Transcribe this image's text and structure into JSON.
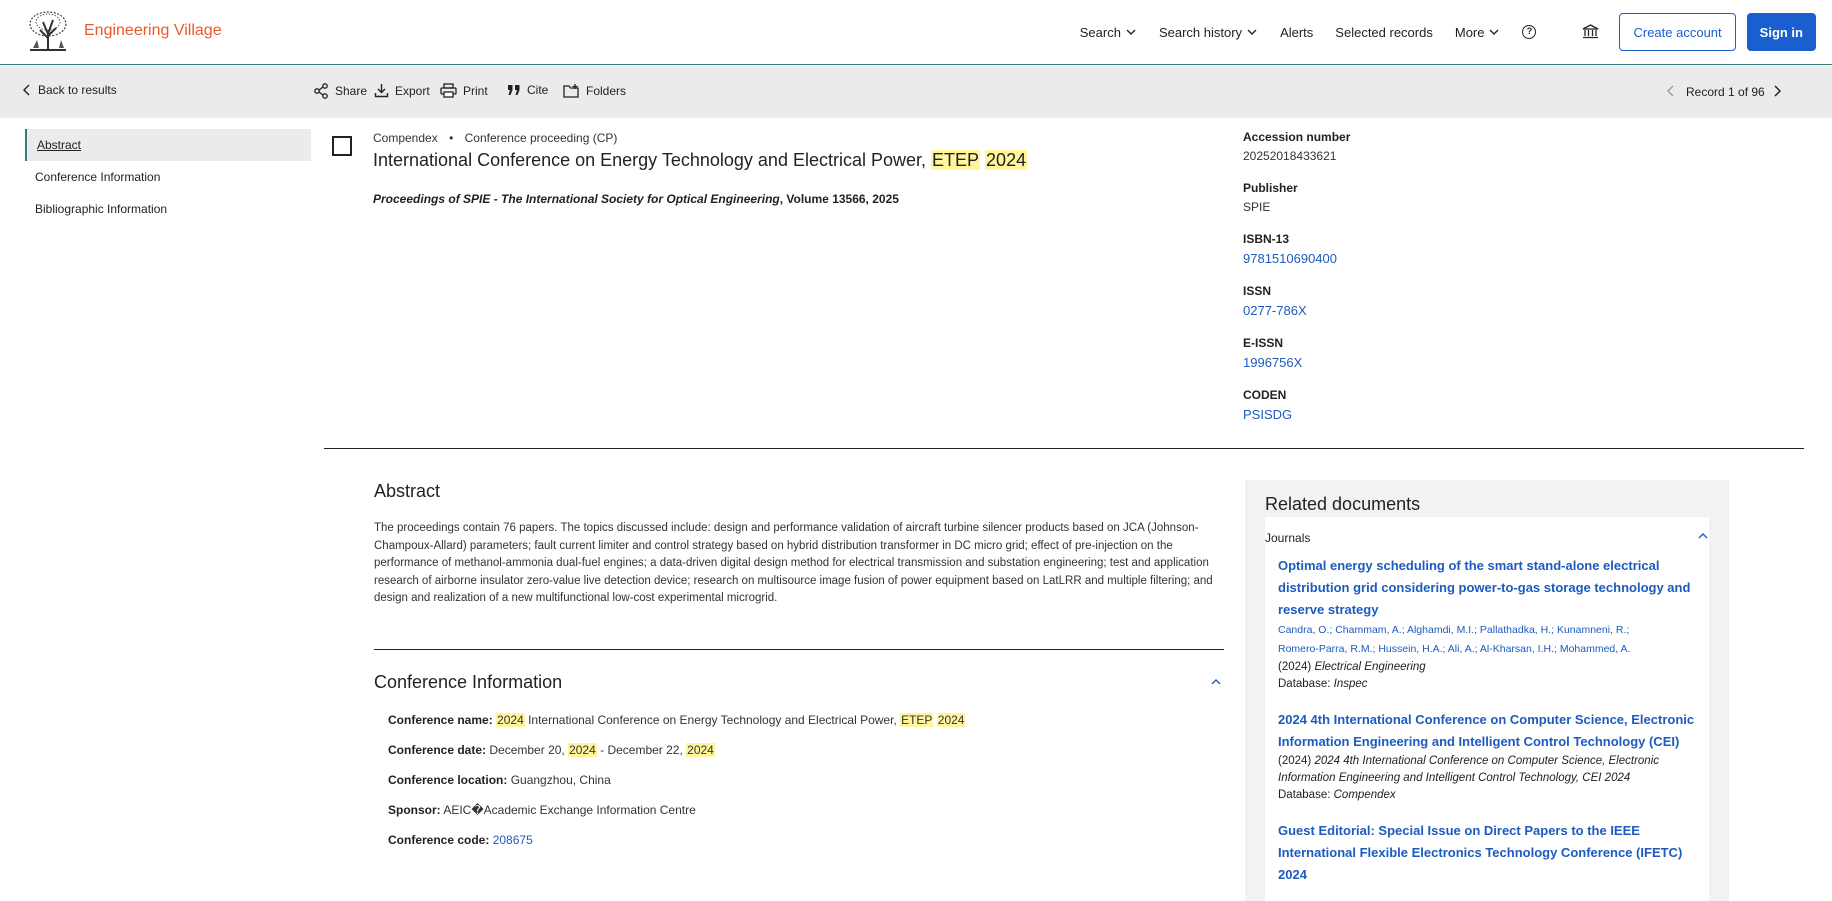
{
  "header": {
    "brand": "Engineering Village",
    "nav": {
      "search": "Search",
      "search_history": "Search history",
      "alerts": "Alerts",
      "selected_records": "Selected records",
      "more": "More"
    },
    "create_account": "Create account",
    "sign_in": "Sign in"
  },
  "toolbar": {
    "back": "Back to results",
    "share": "Share",
    "export": "Export",
    "print": "Print",
    "cite": "Cite",
    "folders": "Folders",
    "record_position": "Record 1 of 96"
  },
  "leftnav": {
    "abstract": "Abstract",
    "conference_information": "Conference Information",
    "bibliographic_information": "Bibliographic Information"
  },
  "record": {
    "database": "Compendex",
    "doc_type": "Conference proceeding (CP)",
    "title_main": "International Conference on Energy Technology and Electrical Power, ",
    "title_hl1": "ETEP",
    "title_hl2": "2024",
    "source_italic": "Proceedings of SPIE - The International Society for Optical Engineering",
    "source_rest": ", Volume 13566, 2025"
  },
  "meta": {
    "accession_label": "Accession number",
    "accession_value": "20252018433621",
    "publisher_label": "Publisher",
    "publisher_value": "SPIE",
    "isbn_label": "ISBN-13",
    "isbn_value": "9781510690400",
    "issn_label": "ISSN",
    "issn_value": "0277-786X",
    "eissn_label": "E-ISSN",
    "eissn_value": "1996756X",
    "coden_label": "CODEN",
    "coden_value": "PSISDG"
  },
  "abstract": {
    "title": "Abstract",
    "text": "The proceedings contain 76 papers. The topics discussed include: design and performance validation of aircraft turbine silencer products based on JCA (Johnson-Champoux-Allard) parameters; fault current limiter and control strategy based on hybrid distribution transformer in DC micro grid; effect of pre-injection on the performance of methanol-ammonia dual-fuel engines; a data-driven digital design method for electrical transmission and substation engineering; test and application research of airborne insulator zero-value live detection device; research on multisource image fusion of power equipment based on LatLRR and multiple filtering; and design and realization of a new multifunctional low-cost experimental microgrid."
  },
  "conference": {
    "title": "Conference Information",
    "name_label": "Conference name:",
    "name_hl_year": "2024",
    "name_text": " International Conference on Energy Technology and Electrical Power, ",
    "name_hl_etep": "ETEP",
    "name_hl_year2": "2024",
    "date_label": "Conference date:",
    "date_part1": "December 20, ",
    "date_hl1": "2024",
    "date_part2": " - December 22, ",
    "date_hl2": "2024",
    "location_label": "Conference location:",
    "location_value": "Guangzhou, China",
    "sponsor_label": "Sponsor:",
    "sponsor_value": "AEIC�Academic Exchange Information Centre",
    "code_label": "Conference code:",
    "code_value": "208675"
  },
  "related": {
    "title": "Related documents",
    "section": "Journals",
    "docs": [
      {
        "title": "Optimal energy scheduling of the smart stand-alone electrical distribution grid considering power-to-gas storage technology and reserve strategy",
        "authors_line1": "Candra, O.;  Chammam, A.;  Alghamdi, M.I.;  Pallathadka, H.;  Kunamneni, R.;",
        "authors_line2": "Romero-Parra, R.M.;  Hussein, H.A.;      Ali, A.;      Al-Kharsan, I.H.;  Mohammed, A.",
        "year": "(2024) ",
        "journal": "Electrical Engineering",
        "database_label": "Database: ",
        "database": "Inspec"
      },
      {
        "title": "2024 4th International Conference on Computer Science, Electronic Information Engineering and Intelligent Control Technology (CEI)",
        "year": "(2024) ",
        "journal": "2024 4th International Conference on Computer Science, Electronic Information Engineering and Intelligent Control Technology, CEI 2024",
        "database_label": "Database: ",
        "database": "Compendex"
      },
      {
        "title": "Guest Editorial: Special Issue on Direct Papers to the IEEE International Flexible Electronics Technology Conference (IFETC) 2024"
      }
    ]
  }
}
